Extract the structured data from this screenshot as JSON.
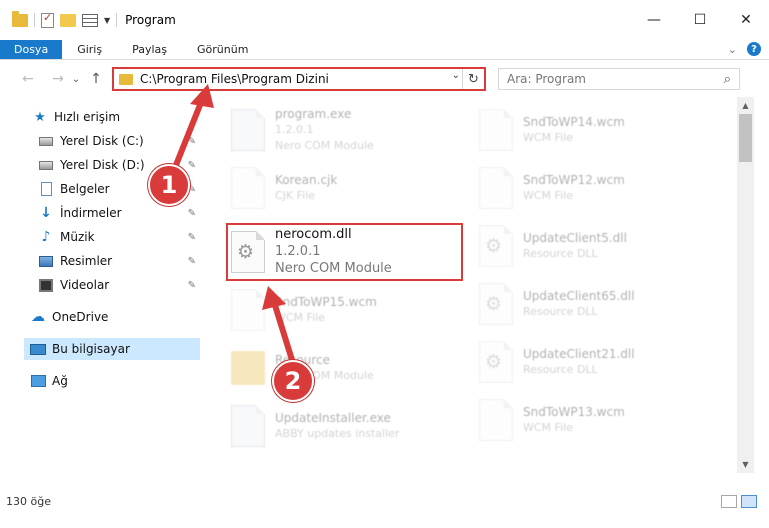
{
  "window": {
    "title": "Program",
    "minimize": "—",
    "maximize": "☐",
    "close": "✕"
  },
  "ribbon": {
    "tabs": [
      {
        "label": "Dosya",
        "active": true
      },
      {
        "label": "Giriş"
      },
      {
        "label": "Paylaş"
      },
      {
        "label": "Görünüm"
      }
    ],
    "expand": "⌄",
    "help": "?"
  },
  "nav": {
    "back": "←",
    "forward": "→",
    "recent": "⌄",
    "up": "↑",
    "address": "C:\\Program Files\\Program Dizini",
    "address_dropdown": "⌄",
    "refresh": "↻",
    "search_placeholder": "Ara: Program",
    "search_icon": "⌕"
  },
  "sidebar": {
    "quick_access": "Hızlı erişim",
    "items": [
      {
        "label": "Yerel Disk (C:)",
        "icon": "disk-icon",
        "pinned": true
      },
      {
        "label": "Yerel Disk (D:)",
        "icon": "disk-icon",
        "pinned": true
      },
      {
        "label": "Belgeler",
        "icon": "documents-icon",
        "pinned": true
      },
      {
        "label": "İndirmeler",
        "icon": "downloads-icon",
        "pinned": true
      },
      {
        "label": "Müzik",
        "icon": "music-icon",
        "pinned": true
      },
      {
        "label": "Resimler",
        "icon": "pictures-icon",
        "pinned": true
      },
      {
        "label": "Videolar",
        "icon": "videos-icon",
        "pinned": true
      }
    ],
    "onedrive": "OneDrive",
    "this_pc": "Bu bilgisayar",
    "network": "Ağ",
    "pin_glyph": "📌"
  },
  "files": {
    "left": [
      {
        "name": "program.exe",
        "line2": "1.2.0.1",
        "line3": "Nero COM Module"
      },
      {
        "name": "Korean.cjk",
        "line2": "CJK File",
        "line3": ""
      },
      {
        "name": "nerocom.dll",
        "line2": "1.2.0.1",
        "line3": "Nero COM Module"
      },
      {
        "name": "SndToWP15.wcm",
        "line2": "WCM File",
        "line3": ""
      },
      {
        "name": "Resource",
        "line2": "",
        "line3": "Nero COM Module"
      },
      {
        "name": "UpdateInstaller.exe",
        "line2": "ABBY updates installer",
        "line3": ""
      }
    ],
    "right": [
      {
        "name": "SndToWP14.wcm",
        "line2": "WCM File"
      },
      {
        "name": "SndToWP12.wcm",
        "line2": "WCM File"
      },
      {
        "name": "UpdateClient5.dll",
        "line2": "Resource DLL"
      },
      {
        "name": "UpdateClient65.dll",
        "line2": "Resource DLL"
      },
      {
        "name": "UpdateClient21.dll",
        "line2": "Resource DLL"
      },
      {
        "name": "SndToWP13.wcm",
        "line2": "WCM File"
      }
    ]
  },
  "status": {
    "count": "130 öğe"
  },
  "annotations": {
    "step1": "1",
    "step2": "2",
    "color": "#d93a3a"
  },
  "colors": {
    "accent": "#1979ca",
    "highlight": "#d93a3a",
    "selection": "#cce8ff"
  }
}
